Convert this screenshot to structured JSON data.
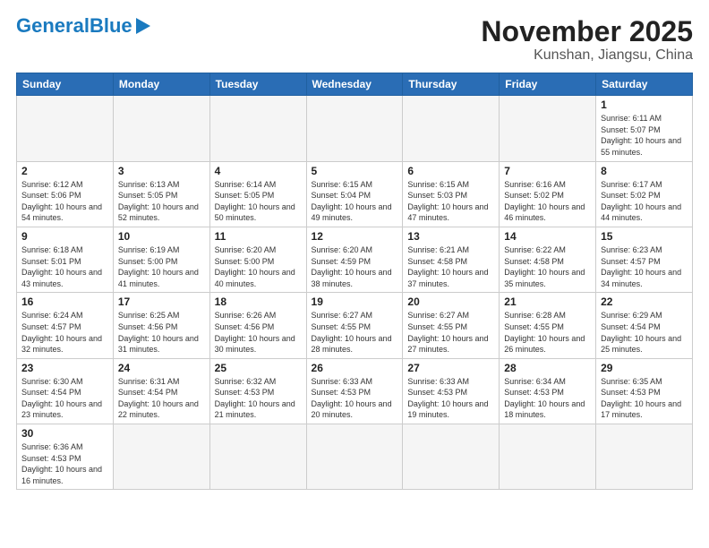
{
  "header": {
    "logo_general": "General",
    "logo_blue": "Blue",
    "title": "November 2025",
    "subtitle": "Kunshan, Jiangsu, China"
  },
  "weekdays": [
    "Sunday",
    "Monday",
    "Tuesday",
    "Wednesday",
    "Thursday",
    "Friday",
    "Saturday"
  ],
  "weeks": [
    [
      {
        "day": "",
        "info": ""
      },
      {
        "day": "",
        "info": ""
      },
      {
        "day": "",
        "info": ""
      },
      {
        "day": "",
        "info": ""
      },
      {
        "day": "",
        "info": ""
      },
      {
        "day": "",
        "info": ""
      },
      {
        "day": "1",
        "info": "Sunrise: 6:11 AM\nSunset: 5:07 PM\nDaylight: 10 hours and 55 minutes."
      }
    ],
    [
      {
        "day": "2",
        "info": "Sunrise: 6:12 AM\nSunset: 5:06 PM\nDaylight: 10 hours and 54 minutes."
      },
      {
        "day": "3",
        "info": "Sunrise: 6:13 AM\nSunset: 5:05 PM\nDaylight: 10 hours and 52 minutes."
      },
      {
        "day": "4",
        "info": "Sunrise: 6:14 AM\nSunset: 5:05 PM\nDaylight: 10 hours and 50 minutes."
      },
      {
        "day": "5",
        "info": "Sunrise: 6:15 AM\nSunset: 5:04 PM\nDaylight: 10 hours and 49 minutes."
      },
      {
        "day": "6",
        "info": "Sunrise: 6:15 AM\nSunset: 5:03 PM\nDaylight: 10 hours and 47 minutes."
      },
      {
        "day": "7",
        "info": "Sunrise: 6:16 AM\nSunset: 5:02 PM\nDaylight: 10 hours and 46 minutes."
      },
      {
        "day": "8",
        "info": "Sunrise: 6:17 AM\nSunset: 5:02 PM\nDaylight: 10 hours and 44 minutes."
      }
    ],
    [
      {
        "day": "9",
        "info": "Sunrise: 6:18 AM\nSunset: 5:01 PM\nDaylight: 10 hours and 43 minutes."
      },
      {
        "day": "10",
        "info": "Sunrise: 6:19 AM\nSunset: 5:00 PM\nDaylight: 10 hours and 41 minutes."
      },
      {
        "day": "11",
        "info": "Sunrise: 6:20 AM\nSunset: 5:00 PM\nDaylight: 10 hours and 40 minutes."
      },
      {
        "day": "12",
        "info": "Sunrise: 6:20 AM\nSunset: 4:59 PM\nDaylight: 10 hours and 38 minutes."
      },
      {
        "day": "13",
        "info": "Sunrise: 6:21 AM\nSunset: 4:58 PM\nDaylight: 10 hours and 37 minutes."
      },
      {
        "day": "14",
        "info": "Sunrise: 6:22 AM\nSunset: 4:58 PM\nDaylight: 10 hours and 35 minutes."
      },
      {
        "day": "15",
        "info": "Sunrise: 6:23 AM\nSunset: 4:57 PM\nDaylight: 10 hours and 34 minutes."
      }
    ],
    [
      {
        "day": "16",
        "info": "Sunrise: 6:24 AM\nSunset: 4:57 PM\nDaylight: 10 hours and 32 minutes."
      },
      {
        "day": "17",
        "info": "Sunrise: 6:25 AM\nSunset: 4:56 PM\nDaylight: 10 hours and 31 minutes."
      },
      {
        "day": "18",
        "info": "Sunrise: 6:26 AM\nSunset: 4:56 PM\nDaylight: 10 hours and 30 minutes."
      },
      {
        "day": "19",
        "info": "Sunrise: 6:27 AM\nSunset: 4:55 PM\nDaylight: 10 hours and 28 minutes."
      },
      {
        "day": "20",
        "info": "Sunrise: 6:27 AM\nSunset: 4:55 PM\nDaylight: 10 hours and 27 minutes."
      },
      {
        "day": "21",
        "info": "Sunrise: 6:28 AM\nSunset: 4:55 PM\nDaylight: 10 hours and 26 minutes."
      },
      {
        "day": "22",
        "info": "Sunrise: 6:29 AM\nSunset: 4:54 PM\nDaylight: 10 hours and 25 minutes."
      }
    ],
    [
      {
        "day": "23",
        "info": "Sunrise: 6:30 AM\nSunset: 4:54 PM\nDaylight: 10 hours and 23 minutes."
      },
      {
        "day": "24",
        "info": "Sunrise: 6:31 AM\nSunset: 4:54 PM\nDaylight: 10 hours and 22 minutes."
      },
      {
        "day": "25",
        "info": "Sunrise: 6:32 AM\nSunset: 4:53 PM\nDaylight: 10 hours and 21 minutes."
      },
      {
        "day": "26",
        "info": "Sunrise: 6:33 AM\nSunset: 4:53 PM\nDaylight: 10 hours and 20 minutes."
      },
      {
        "day": "27",
        "info": "Sunrise: 6:33 AM\nSunset: 4:53 PM\nDaylight: 10 hours and 19 minutes."
      },
      {
        "day": "28",
        "info": "Sunrise: 6:34 AM\nSunset: 4:53 PM\nDaylight: 10 hours and 18 minutes."
      },
      {
        "day": "29",
        "info": "Sunrise: 6:35 AM\nSunset: 4:53 PM\nDaylight: 10 hours and 17 minutes."
      }
    ],
    [
      {
        "day": "30",
        "info": "Sunrise: 6:36 AM\nSunset: 4:53 PM\nDaylight: 10 hours and 16 minutes."
      },
      {
        "day": "",
        "info": ""
      },
      {
        "day": "",
        "info": ""
      },
      {
        "day": "",
        "info": ""
      },
      {
        "day": "",
        "info": ""
      },
      {
        "day": "",
        "info": ""
      },
      {
        "day": "",
        "info": ""
      }
    ]
  ]
}
